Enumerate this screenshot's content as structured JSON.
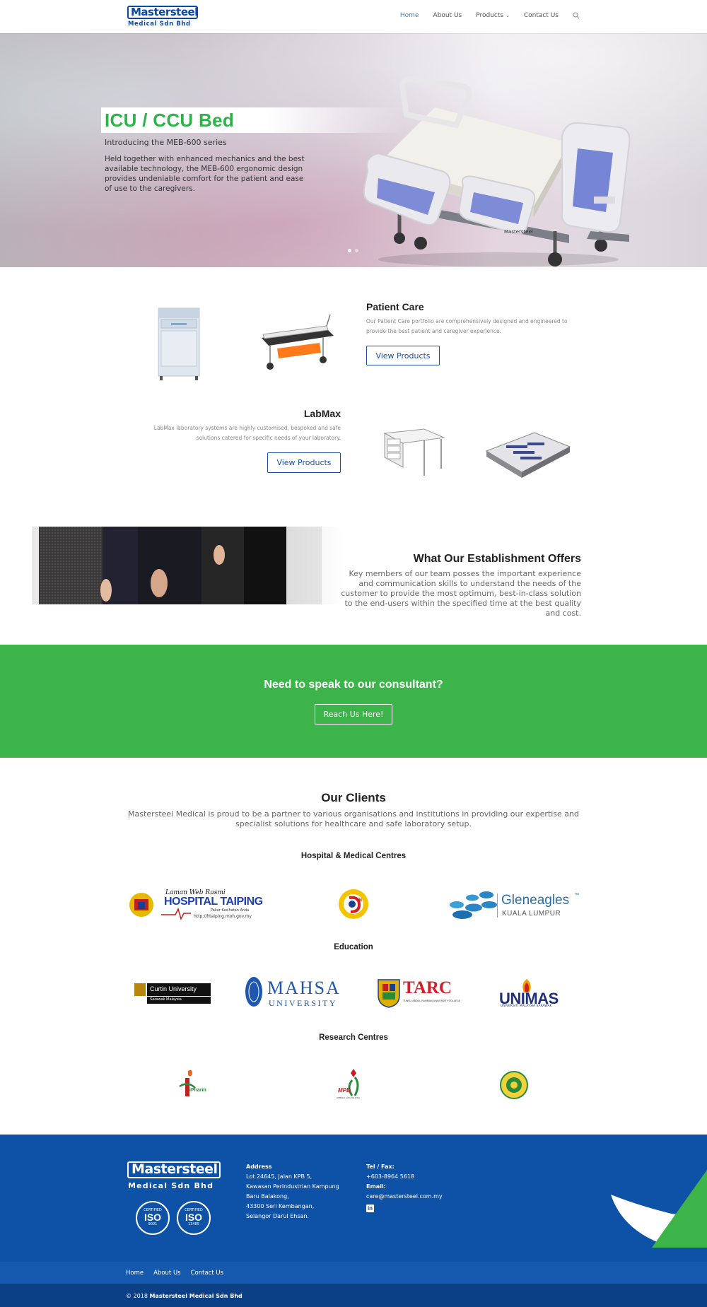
{
  "header": {
    "logo_main": "Mastersteel",
    "logo_sub": "Medical Sdn Bhd",
    "nav": [
      {
        "label": "Home",
        "active": true
      },
      {
        "label": "About Us",
        "active": false
      },
      {
        "label": "Products",
        "active": false
      },
      {
        "label": "Contact Us",
        "active": false
      }
    ]
  },
  "hero": {
    "title": "ICU / CCU Bed",
    "subtitle": "Introducing the MEB-600 series",
    "description": "Held together with enhanced mechanics and the best available technology, the MEB-600 ergonomic design provides undeniable comfort for the patient and ease of use to the caregivers.",
    "bed_label": "Mastersteel",
    "slide_count": 2,
    "active_slide": 1
  },
  "patient_care": {
    "title": "Patient Care",
    "text": "Our Patient Care portfolio are comprehensively designed and engineered to provide the best patient and caregiver experience.",
    "button": "View Products"
  },
  "labmax": {
    "title": "LabMax",
    "text": "LabMax laboratory systems are highly customised, bespoked and safe solutions catered for specific needs of your laboratory.",
    "button": "View Products"
  },
  "establishment": {
    "title": "What Our Establishment Offers",
    "text": "Key members of our team posses the important experience and communication skills to understand the needs of the customer to provide the most optimum, best-in-class solution to the end-users within the specified time at the best quality and cost."
  },
  "cta": {
    "title": "Need to speak to our consultant?",
    "button": "Reach Us Here!"
  },
  "clients": {
    "title": "Our Clients",
    "text": "Mastersteel Medical is proud to be a partner to various organisations and institutions in providing our expertise and specialist solutions for healthcare and safe laboratory setup.",
    "hospital_title": "Hospital & Medical Centres",
    "education_title": "Education",
    "research_title": "Research Centres",
    "logos": {
      "taiping_small": "Laman Web Rasmi",
      "taiping_big": "HOSPITAL TAIPING",
      "taiping_tag": "Pakar Kesihatan Anda",
      "taiping_url": "http://htaiping.moh.gov.my",
      "ijn": "IJN",
      "gleneagles": "Gleneagles",
      "gleneagles_tm": "™",
      "gleneagles_sub": "KUALA LUMPUR",
      "curtin": "Curtin University",
      "curtin_sub": "Sarawak Malaysia",
      "mahsa": "MAHSA",
      "mahsa_sub": "UNIVERSITY",
      "tarc": "TARC",
      "tarc_sub": "TUNKU ABDUL RAHMAN UNIVERSITY COLLEGE",
      "unimas": "UNIMAS",
      "unimas_sub": "UNIVERSITI MALAYSIA SARAWAK",
      "ipharm": "iPharm",
      "mpb": "MPB",
      "mpb_sub": "LEMBAGA LADA MALAYSIA"
    }
  },
  "footer": {
    "logo_main": "Mastersteel",
    "logo_sub": "Medical Sdn Bhd",
    "iso": [
      {
        "top": "CERTIFIED",
        "num": "ISO",
        "bottom": "9001"
      },
      {
        "top": "CERTIFIED",
        "num": "ISO",
        "bottom": "13485"
      }
    ],
    "address_head": "Address",
    "address_lines": [
      "Lot 24645, Jalan KPB 5,",
      "Kawasan Perindustrian Kampung",
      "Baru Balakong,",
      "43300 Seri Kembangan,",
      "Selangor Darul Ehsan."
    ],
    "tel_head": "Tel / Fax:",
    "tel": "+603-8964 5618",
    "email_head": "Email:",
    "email": "care@mastersteel.com.my",
    "linkedin": "in",
    "nav": [
      "Home",
      "About Us",
      "Contact Us"
    ],
    "copyright_prefix": "© 2018 ",
    "copyright_name": "Mastersteel Medical Sdn Bhd"
  },
  "colors": {
    "brand_blue": "#0d52a6",
    "brand_green": "#3cb44a",
    "nav_active": "#2e8de5"
  }
}
